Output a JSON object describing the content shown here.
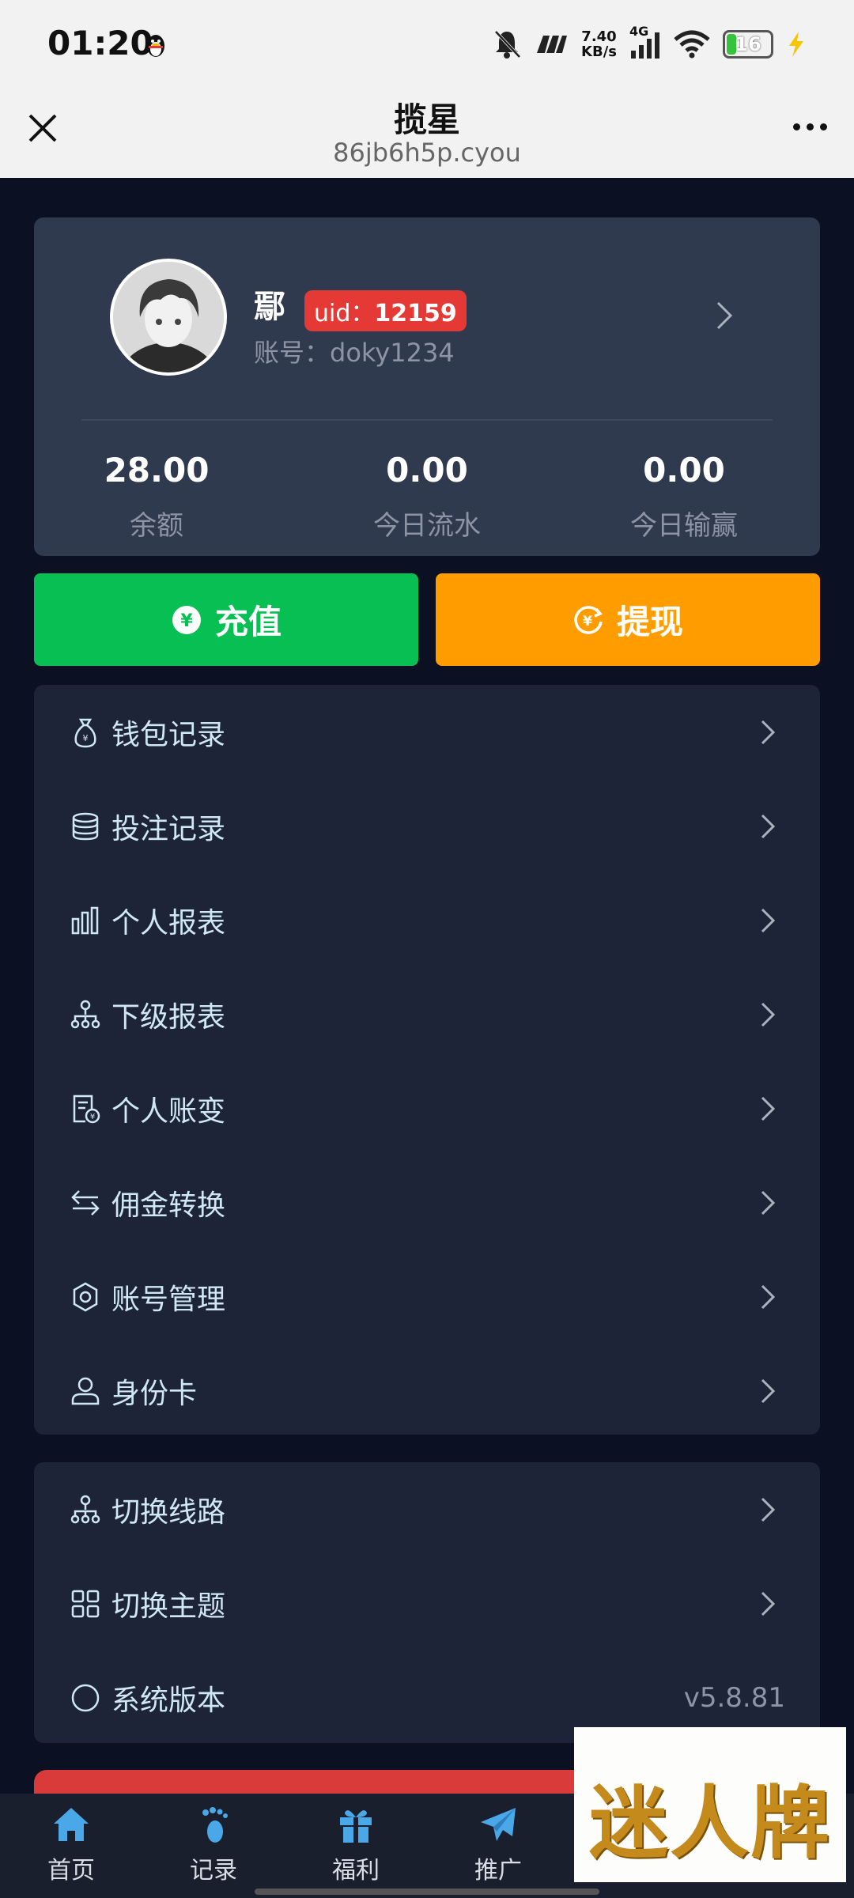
{
  "status_bar": {
    "time": "01:20",
    "net_speed_value": "7.40",
    "net_speed_unit": "KB/s",
    "network": "4G",
    "battery": "16"
  },
  "title_bar": {
    "title": "揽星",
    "url": "86jb6h5p.cyou"
  },
  "profile": {
    "name": "鄢",
    "uid_label": "uid：",
    "uid_value": "12159",
    "account": "账号：doky1234",
    "stats": [
      {
        "value": "28.00",
        "label": "余额"
      },
      {
        "value": "0.00",
        "label": "今日流水"
      },
      {
        "value": "0.00",
        "label": "今日输赢"
      }
    ]
  },
  "actions": {
    "recharge": "充值",
    "withdraw": "提现"
  },
  "colors": {
    "recharge": "#07bf52",
    "withdraw": "#ff9d00",
    "card": "#1d2438",
    "profile_card": "#303a4e",
    "accent_text": "#cfe8f4"
  },
  "menu1": [
    {
      "label": "钱包记录",
      "icon": "money-bag-icon"
    },
    {
      "label": "投注记录",
      "icon": "database-icon"
    },
    {
      "label": "个人报表",
      "icon": "bar-chart-icon"
    },
    {
      "label": "下级报表",
      "icon": "hierarchy-icon"
    },
    {
      "label": "个人账变",
      "icon": "receipt-icon"
    },
    {
      "label": "佣金转换",
      "icon": "swap-icon"
    },
    {
      "label": "账号管理",
      "icon": "settings-icon"
    },
    {
      "label": "身份卡",
      "icon": "user-icon"
    }
  ],
  "menu2": [
    {
      "label": "切换线路",
      "icon": "hierarchy-icon"
    },
    {
      "label": "切换主题",
      "icon": "grid-icon"
    },
    {
      "label": "系统版本",
      "icon": "circle-icon",
      "value": "v5.8.81"
    }
  ],
  "tabs": [
    {
      "label": "首页",
      "icon": "home-icon"
    },
    {
      "label": "记录",
      "icon": "footprint-icon"
    },
    {
      "label": "福利",
      "icon": "gift-icon"
    },
    {
      "label": "推广",
      "icon": "paper-plane-icon"
    }
  ],
  "watermark": "迷人牌"
}
